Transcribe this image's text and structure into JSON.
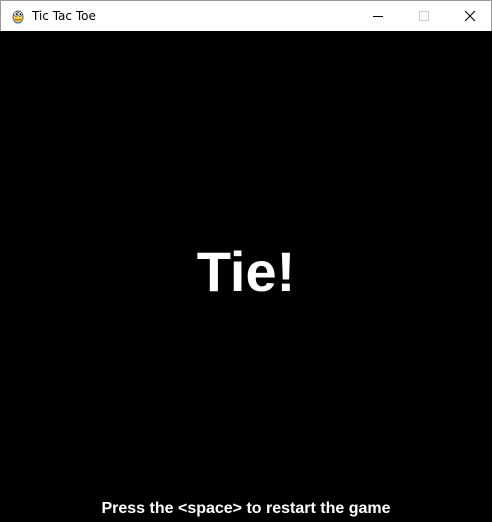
{
  "window": {
    "title": "Tic Tac Toe",
    "icon": "pygame-snake-icon"
  },
  "controls": {
    "minimize_icon": "minimize-icon",
    "maximize_icon": "maximize-icon",
    "close_icon": "close-icon"
  },
  "game": {
    "result": "Tie!",
    "restart_hint": "Press the <space> to restart the game"
  },
  "colors": {
    "background": "#000000",
    "text": "#ffffff",
    "titlebar": "#ffffff"
  }
}
